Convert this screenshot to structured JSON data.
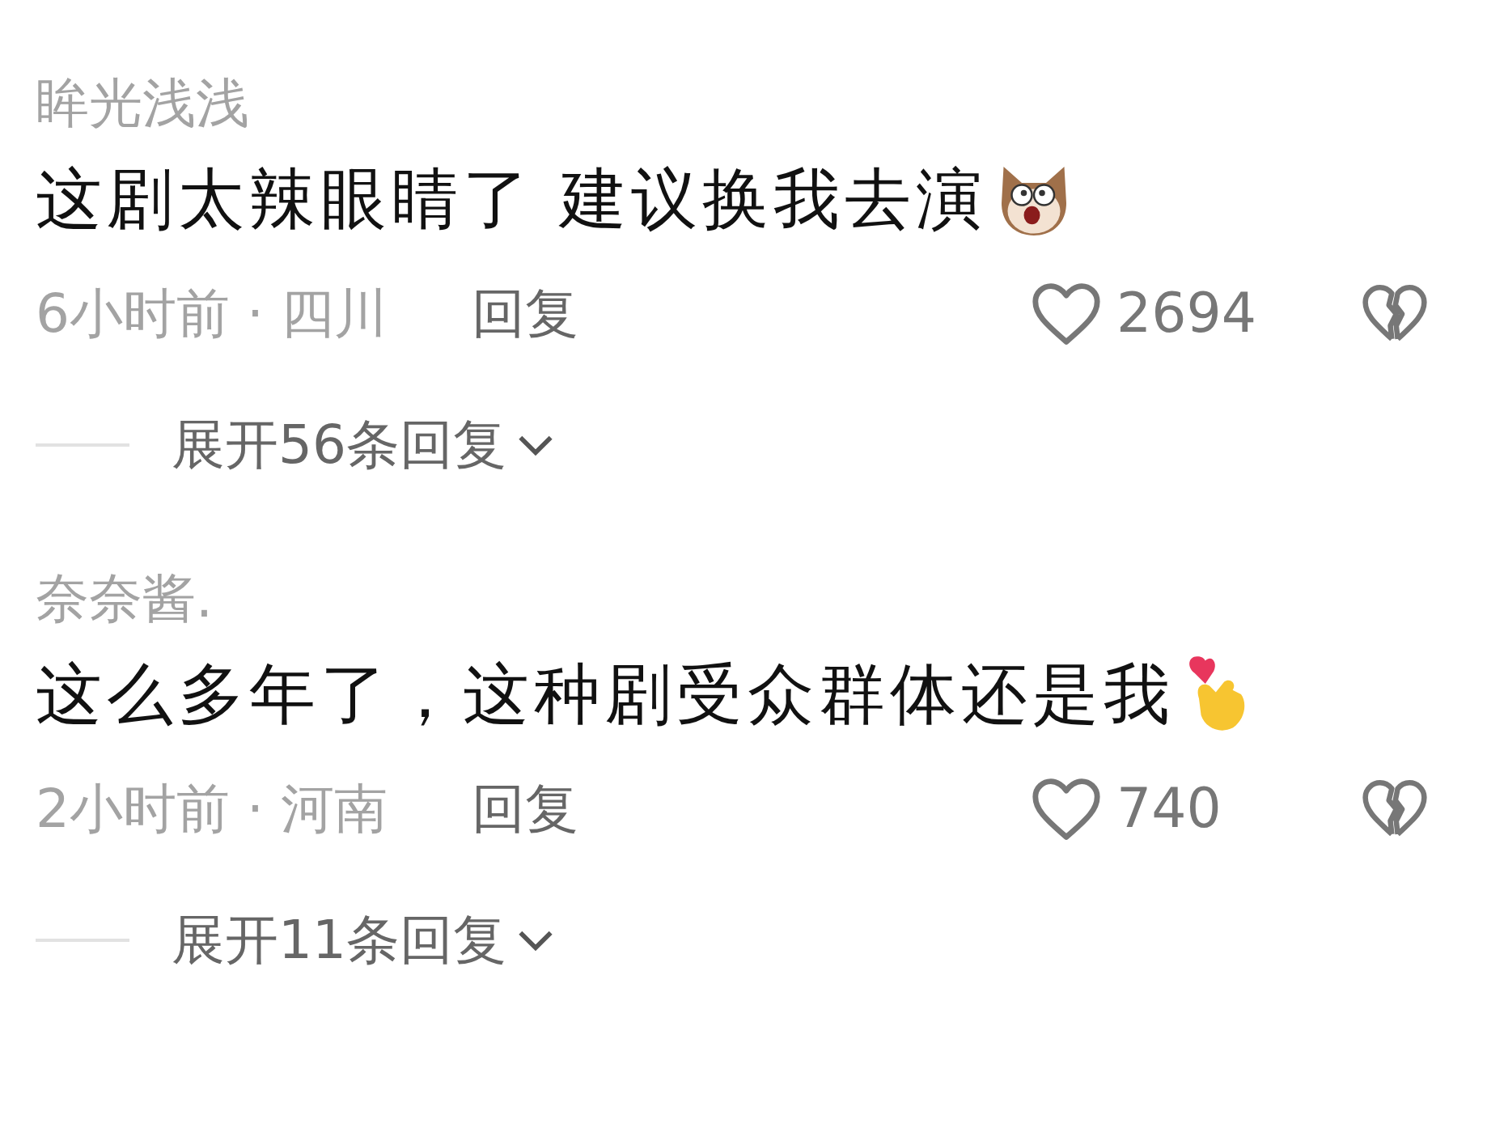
{
  "comments": [
    {
      "username": "眸光浅浅",
      "text": "这剧太辣眼睛了 建议换我去演",
      "time_location": "6小时前 · 四川",
      "reply_label": "回复",
      "likes": "2694",
      "expand_label": "展开56条回复"
    },
    {
      "username": "奈奈酱.",
      "text": "这么多年了，这种剧受众群体还是我",
      "time_location": "2小时前 · 河南",
      "reply_label": "回复",
      "likes": "740",
      "expand_label": "展开11条回复"
    }
  ]
}
